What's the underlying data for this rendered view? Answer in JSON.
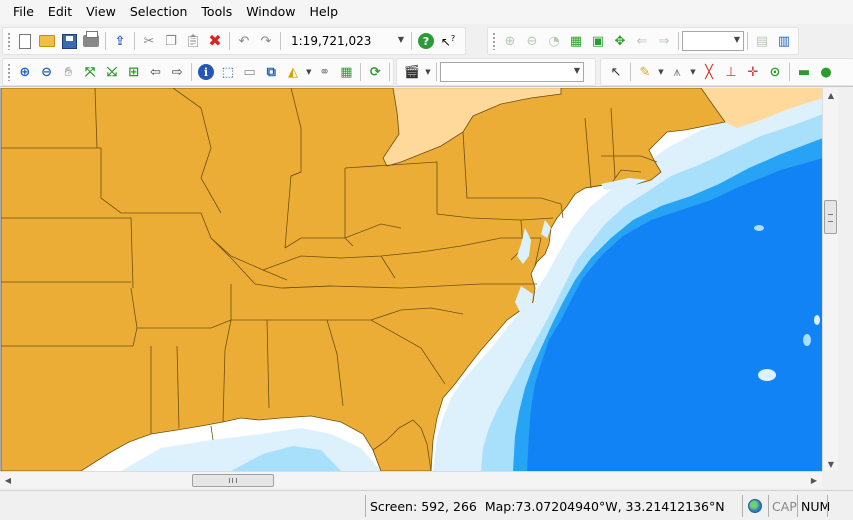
{
  "menu": [
    "File",
    "Edit",
    "View",
    "Selection",
    "Tools",
    "Window",
    "Help"
  ],
  "toolbar": {
    "scale_value": "1:19,721,023",
    "zoom_combo_value": "",
    "layer_combo_value": "",
    "icons_row1": [
      "new-document",
      "open-folder",
      "save",
      "print",
      "export",
      "cut",
      "copy",
      "paste",
      "delete",
      "undo",
      "redo",
      "scale-dropdown",
      "help",
      "whats-this"
    ],
    "icons_row1b": [
      "zoom-in-disabled",
      "zoom-out-disabled",
      "zoom-full",
      "zoom-layer",
      "zoom-selection",
      "pan-disabled",
      "back-disabled",
      "forward-disabled"
    ],
    "icons_row2": [
      "zoom-in",
      "zoom-out",
      "pan",
      "full-extent",
      "fixed-zoom-in",
      "fixed-zoom-out",
      "zoom-selection",
      "back",
      "forward",
      "identify",
      "select-features",
      "map-tips",
      "html-popup",
      "measure",
      "hyperlink",
      "table",
      "refresh",
      "camera",
      "layer-dropdown",
      "edit-tool",
      "sketch",
      "construct",
      "snap",
      "cogo",
      "trace"
    ]
  },
  "colors": {
    "land": "#EBAD36",
    "land_other": "#FFD89C",
    "ocean_deep": "#1283F5",
    "ocean_mid": "#27A3F5",
    "ocean_shallow": "#A8DFFB",
    "ocean_shelf": "#DDF1FD",
    "border": "#6E5010"
  },
  "status": {
    "screen_label": "Screen:",
    "screen_value": "592, 266",
    "map_label": "Map:",
    "map_value": "73.07204940°W, 33.21412136°N",
    "caps": "CAP",
    "num": "NUM"
  },
  "scrollbar_labels": {
    "hthumb": "|||"
  }
}
